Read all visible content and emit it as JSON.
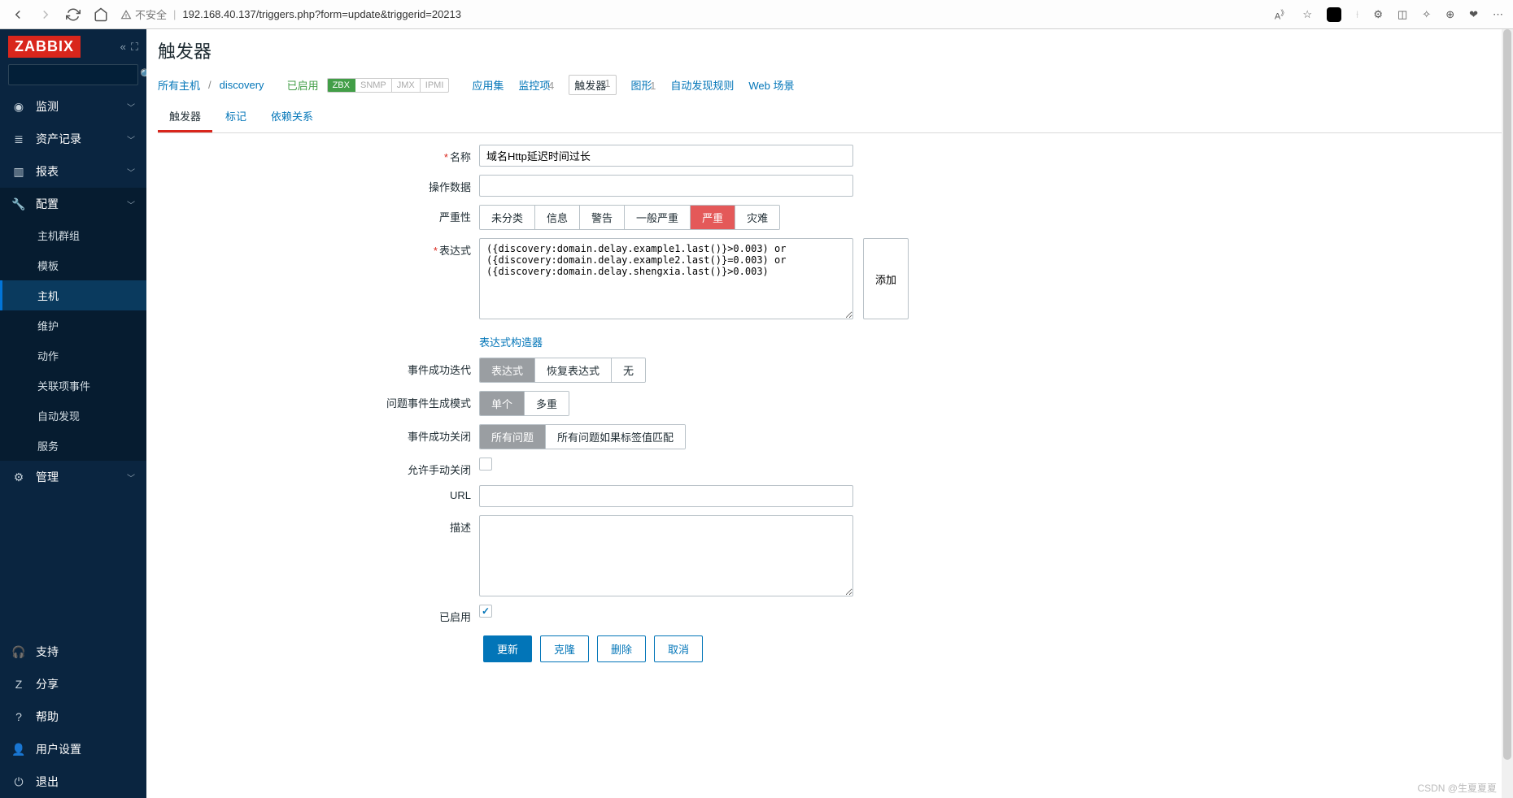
{
  "browser": {
    "insecure_label": "不安全",
    "url": "192.168.40.137/triggers.php?form=update&triggerid=20213"
  },
  "logo": "ZABBIX",
  "sidebar": {
    "items": [
      {
        "icon": "◉",
        "label": "监测"
      },
      {
        "icon": "≣",
        "label": "资产记录"
      },
      {
        "icon": "▥",
        "label": "报表"
      },
      {
        "icon": "🔧",
        "label": "配置",
        "expanded": true,
        "sub": [
          {
            "label": "主机群组"
          },
          {
            "label": "模板"
          },
          {
            "label": "主机",
            "active": true
          },
          {
            "label": "维护"
          },
          {
            "label": "动作"
          },
          {
            "label": "关联项事件"
          },
          {
            "label": "自动发现"
          },
          {
            "label": "服务"
          }
        ]
      },
      {
        "icon": "⚙",
        "label": "管理"
      }
    ],
    "bottom": [
      {
        "icon": "🎧",
        "label": "支持"
      },
      {
        "icon": "Z",
        "label": "分享"
      },
      {
        "icon": "?",
        "label": "帮助"
      },
      {
        "icon": "👤",
        "label": "用户设置"
      },
      {
        "icon": "⏻",
        "label": "退出"
      }
    ]
  },
  "page": {
    "title": "触发器",
    "breadcrumb": {
      "all_hosts": "所有主机",
      "host": "discovery",
      "enabled": "已启用",
      "badges": [
        "ZBX",
        "SNMP",
        "JMX",
        "IPMI"
      ],
      "links": [
        {
          "label": "应用集",
          "count": ""
        },
        {
          "label": "监控项",
          "count": "4"
        },
        {
          "label": "触发器",
          "count": "1",
          "active": true
        },
        {
          "label": "图形",
          "count": "1"
        },
        {
          "label": "自动发现规则",
          "count": ""
        },
        {
          "label": "Web 场景",
          "count": ""
        }
      ]
    },
    "tabs": [
      "触发器",
      "标记",
      "依赖关系"
    ],
    "tab_active": 0
  },
  "form": {
    "name": {
      "label": "名称",
      "value": "域名Http延迟时间过长",
      "required": true
    },
    "opdata": {
      "label": "操作数据",
      "value": ""
    },
    "severity": {
      "label": "严重性",
      "options": [
        "未分类",
        "信息",
        "警告",
        "一般严重",
        "严重",
        "灾难"
      ],
      "active": 4
    },
    "expression": {
      "label": "表达式",
      "required": true,
      "add_btn": "添加",
      "builder": "表达式构造器",
      "value": "({discovery:domain.delay.example1.last()}>0.003) or\n({discovery:domain.delay.example2.last()}=0.003) or\n({discovery:domain.delay.shengxia.last()}>0.003)"
    },
    "ok_event": {
      "label": "事件成功迭代",
      "options": [
        "表达式",
        "恢复表达式",
        "无"
      ],
      "active": 0
    },
    "problem_mode": {
      "label": "问题事件生成模式",
      "options": [
        "单个",
        "多重"
      ],
      "active": 0
    },
    "ok_close": {
      "label": "事件成功关闭",
      "options": [
        "所有问题",
        "所有问题如果标签值匹配"
      ],
      "active": 0
    },
    "manual_close": {
      "label": "允许手动关闭",
      "checked": false
    },
    "url": {
      "label": "URL",
      "value": ""
    },
    "description": {
      "label": "描述",
      "value": ""
    },
    "enabled": {
      "label": "已启用",
      "checked": true
    },
    "actions": {
      "update": "更新",
      "clone": "克隆",
      "delete": "删除",
      "cancel": "取消"
    }
  },
  "watermark": "CSDN @生夏夏夏"
}
